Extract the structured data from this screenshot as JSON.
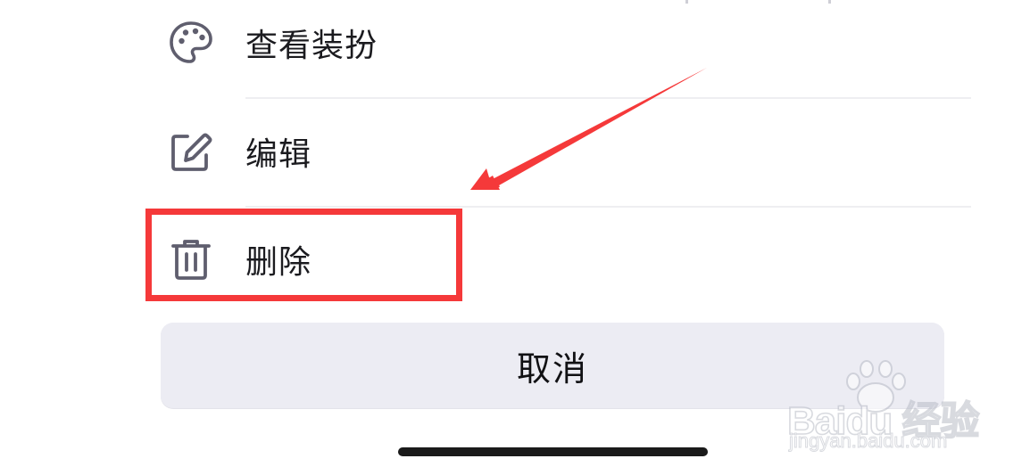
{
  "action_sheet": {
    "items": [
      {
        "label": "查看装扮",
        "icon": "palette-icon"
      },
      {
        "label": "编辑",
        "icon": "edit-icon"
      },
      {
        "label": "删除",
        "icon": "trash-icon"
      }
    ],
    "cancel_label": "取消"
  },
  "annotation": {
    "color": "#f5393a",
    "target": "删除"
  },
  "watermark": {
    "brand": "Baidu 经验",
    "domain": "jingyan.baidu.com"
  },
  "colors": {
    "icon": "#5f5e6e",
    "text": "#1b1b1f",
    "cancel_bg": "#ececf3"
  }
}
